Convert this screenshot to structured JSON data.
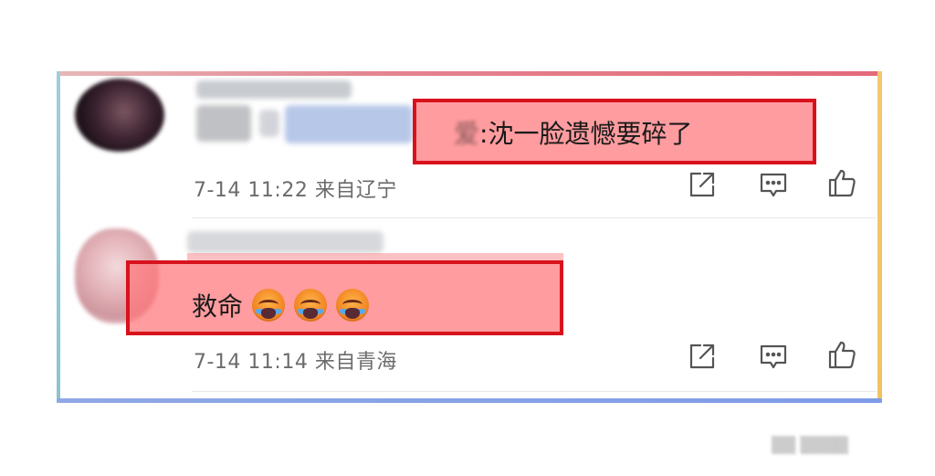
{
  "comments": [
    {
      "text_prefix": "爱",
      "text": ":沈一脸遗憾要碎了",
      "time": "7-14 11:22",
      "location": "来自辽宁"
    },
    {
      "text": "救命",
      "emoji": [
        "crying-face-icon",
        "crying-face-icon",
        "crying-face-icon"
      ],
      "time": "7-14 11:14",
      "location": "来自青海"
    }
  ],
  "actions": {
    "share_icon": "share-icon",
    "comment_icon": "comment-icon",
    "like_icon": "thumbs-up-icon"
  },
  "colors": {
    "highlight_fill": "#ff767a",
    "highlight_border": "#d8121c",
    "meta_text": "#6b6b6b"
  }
}
